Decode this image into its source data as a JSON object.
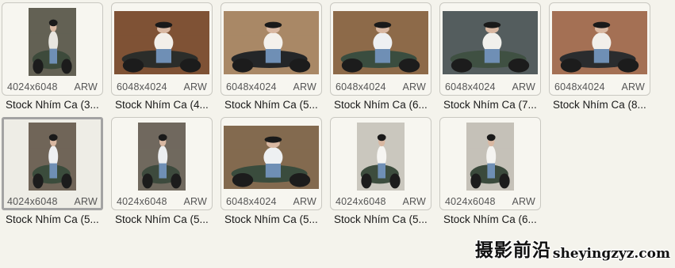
{
  "files": [
    {
      "dims": "4024x6048",
      "type": "ARW",
      "name": "Stock Nhím Ca (3...",
      "orientation": "portrait",
      "palette": {
        "bg": "#6c6a5c",
        "fg": "#3d4a3b",
        "accent": "#e8e6e0"
      },
      "selected": false
    },
    {
      "dims": "6048x4024",
      "type": "ARW",
      "name": "Stock Nhím Ca (4...",
      "orientation": "landscape",
      "palette": {
        "bg": "#8a5a3a",
        "fg": "#2b2d2a",
        "accent": "#f3efe9"
      },
      "selected": false
    },
    {
      "dims": "6048x4024",
      "type": "ARW",
      "name": "Stock Nhím Ca (5...",
      "orientation": "landscape",
      "palette": {
        "bg": "#b8946f",
        "fg": "#242628",
        "accent": "#f4f1ec"
      },
      "selected": false
    },
    {
      "dims": "6048x4024",
      "type": "ARW",
      "name": "Stock Nhím Ca (6...",
      "orientation": "landscape",
      "palette": {
        "bg": "#9a7450",
        "fg": "#3a4d3f",
        "accent": "#eef0f2"
      },
      "selected": false
    },
    {
      "dims": "6048x4024",
      "type": "ARW",
      "name": "Stock Nhím Ca (7...",
      "orientation": "landscape",
      "palette": {
        "bg": "#5c6566",
        "fg": "#3f5042",
        "accent": "#f1f0ec"
      },
      "selected": false
    },
    {
      "dims": "6048x4024",
      "type": "ARW",
      "name": "Stock Nhím Ca (8...",
      "orientation": "landscape",
      "palette": {
        "bg": "#b27a5c",
        "fg": "#2a2c2e",
        "accent": "#f2efea"
      },
      "selected": false
    },
    {
      "dims": "4024x6048",
      "type": "ARW",
      "name": "Stock Nhím Ca (5...",
      "orientation": "portrait",
      "palette": {
        "bg": "#7a6e60",
        "fg": "#3b4c3c",
        "accent": "#eef0f3"
      },
      "selected": true
    },
    {
      "dims": "4024x6048",
      "type": "ARW",
      "name": "Stock Nhím Ca (5...",
      "orientation": "portrait",
      "palette": {
        "bg": "#7a7266",
        "fg": "#3d4a3d",
        "accent": "#eceef0"
      },
      "selected": false
    },
    {
      "dims": "6048x4024",
      "type": "ARW",
      "name": "Stock Nhím Ca (5...",
      "orientation": "landscape",
      "palette": {
        "bg": "#8f7356",
        "fg": "#3a4c3d",
        "accent": "#eef0f2"
      },
      "selected": false
    },
    {
      "dims": "4024x6048",
      "type": "ARW",
      "name": "Stock Nhím Ca (5...",
      "orientation": "portrait",
      "palette": {
        "bg": "#dcd8cf",
        "fg": "#3d4d3e",
        "accent": "#f6f5f2"
      },
      "selected": false
    },
    {
      "dims": "4024x6048",
      "type": "ARW",
      "name": "Stock Nhím Ca (6...",
      "orientation": "portrait",
      "palette": {
        "bg": "#d6d2c8",
        "fg": "#3b4a3c",
        "accent": "#f5f4f1"
      },
      "selected": false
    }
  ],
  "watermark": {
    "cn": "摄影前沿",
    "en": "sheyingzyz.com"
  }
}
